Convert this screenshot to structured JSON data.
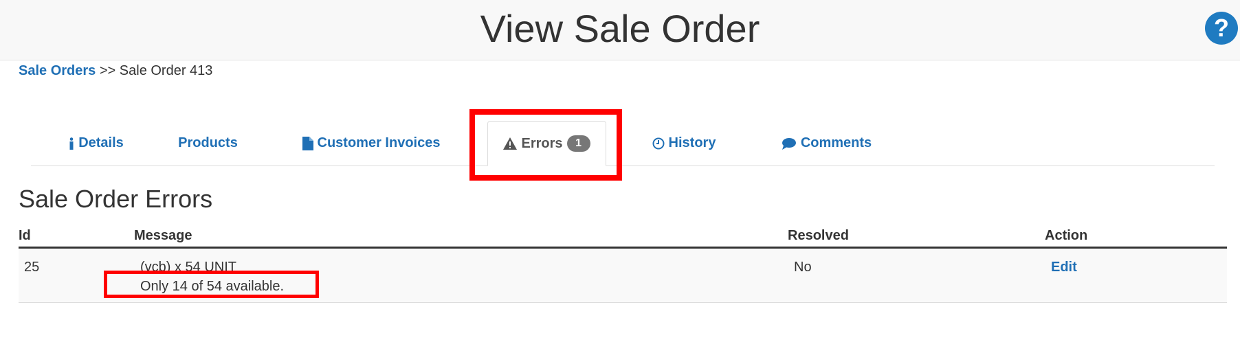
{
  "header": {
    "title": "View Sale Order",
    "help_icon": "question-circle-icon"
  },
  "breadcrumb": {
    "link_label": "Sale Orders",
    "separator": ">>",
    "current": "Sale Order 413"
  },
  "tabs": [
    {
      "label": "Details",
      "icon": "info-icon"
    },
    {
      "label": "Products"
    },
    {
      "label": "Customer Invoices",
      "icon": "file-icon"
    },
    {
      "label": "Errors",
      "icon": "warning-icon",
      "badge": "1",
      "active": true
    },
    {
      "label": "History",
      "icon": "clock-icon"
    },
    {
      "label": "Comments",
      "icon": "comment-icon"
    }
  ],
  "errors_section": {
    "title": "Sale Order Errors",
    "columns": {
      "id": "Id",
      "message": "Message",
      "resolved": "Resolved",
      "action": "Action"
    },
    "rows": [
      {
        "id": "25",
        "message_line1": "(vcb) x 54 UNIT",
        "message_line2": "Only 14 of 54 available.",
        "resolved": "No",
        "action": "Edit"
      }
    ]
  },
  "colors": {
    "link": "#1f6fb5",
    "highlight": "#ff0000",
    "badge": "#777777",
    "help": "#1f7bc1"
  }
}
